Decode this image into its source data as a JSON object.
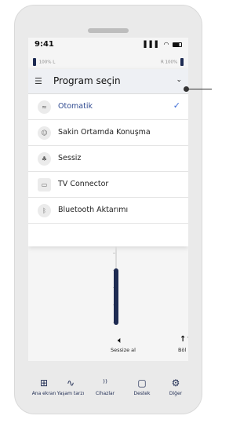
{
  "status_bar": {
    "time": "9:41",
    "signal": "▌▌▌",
    "wifi": "◠"
  },
  "devices": {
    "left": "100% L",
    "right": "R 100%"
  },
  "program_menu": {
    "title": "Program seçin",
    "options": [
      {
        "label": "Otomatik",
        "icon": "automatic-icon",
        "selected": true
      },
      {
        "label": "Sakin Ortamda Konuşma",
        "icon": "speech-quiet-icon",
        "selected": false
      },
      {
        "label": "Sessiz",
        "icon": "quiet-icon",
        "selected": false
      },
      {
        "label": "TV Connector",
        "icon": "tv-connector-icon",
        "selected": false
      },
      {
        "label": "Bluetooth Aktarımı",
        "icon": "bluetooth-icon",
        "selected": false
      }
    ]
  },
  "volume": {
    "level": 0.8
  },
  "actions": {
    "mute_label": "Sessize al",
    "split_label": "Böl"
  },
  "tabbar": {
    "items": [
      {
        "label": "Ana ekran",
        "icon": "home-grid-icon"
      },
      {
        "label": "Yaşam tarzı",
        "icon": "lifestyle-icon"
      },
      {
        "label": "Cihazlar",
        "icon": "devices-icon"
      },
      {
        "label": "Destek",
        "icon": "support-icon"
      },
      {
        "label": "Diğer",
        "icon": "settings-icon"
      }
    ]
  },
  "colors": {
    "accent": "#2f4a90",
    "check": "#3a6ad6",
    "navy": "#1e2b52"
  }
}
